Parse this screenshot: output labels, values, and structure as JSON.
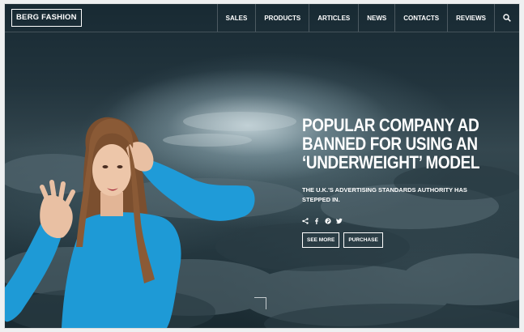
{
  "brand": {
    "logo_text": "BERG FASHION"
  },
  "nav": {
    "items": [
      {
        "label": "SALES"
      },
      {
        "label": "PRODUCTS"
      },
      {
        "label": "ARTICLES"
      },
      {
        "label": "NEWS"
      },
      {
        "label": "CONTACTS"
      },
      {
        "label": "REVIEWS"
      }
    ],
    "search_icon": "search-icon"
  },
  "hero": {
    "title_lines": [
      "POPULAR COMPANY AD",
      "BANNED FOR USING AN",
      "‘UNDERWEIGHT’ MODEL"
    ],
    "subtitle": "THE U.K.'S ADVERTISING STANDARDS AUTHORITY HAS STEPPED IN.",
    "social_icons": [
      "share-icon",
      "facebook-icon",
      "pinterest-icon",
      "twitter-icon"
    ],
    "buttons": {
      "see_more": "SEE MORE",
      "purchase": "PURCHASE"
    }
  },
  "colors": {
    "text": "#ffffff",
    "sky_dark": "#1c2e36",
    "model_top": "#1e9ad6",
    "hair": "#8a5a36"
  }
}
